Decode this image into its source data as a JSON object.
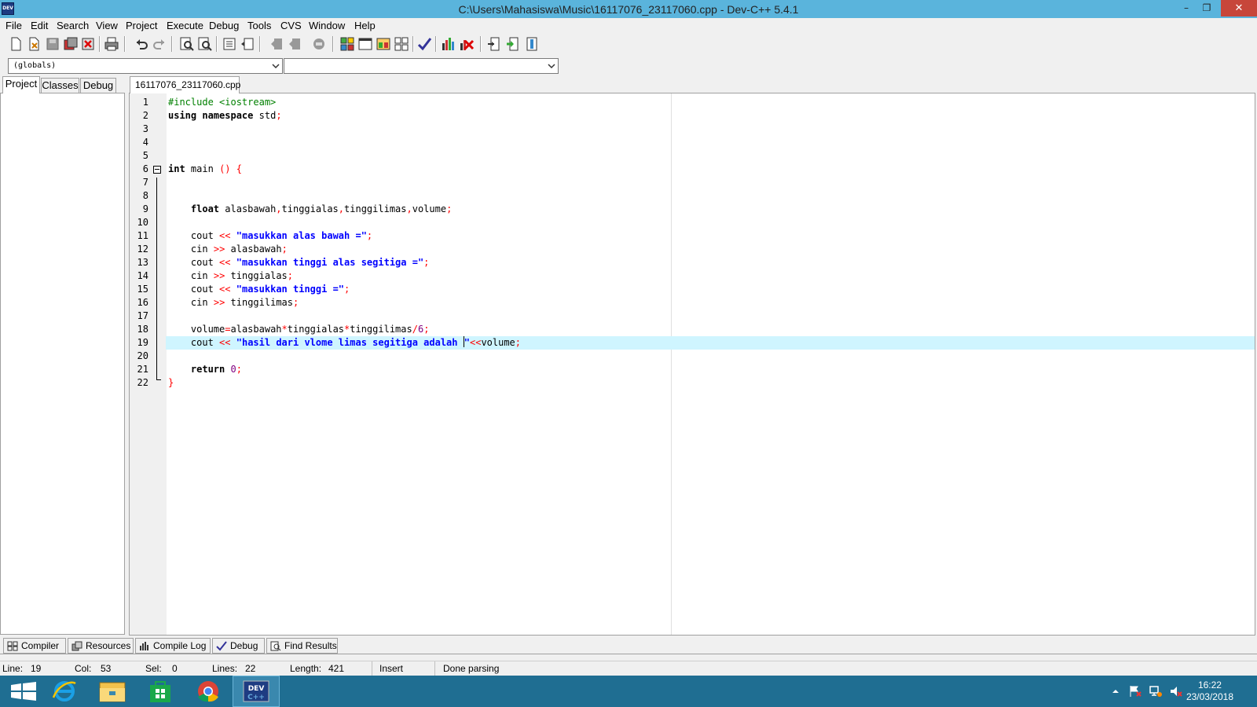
{
  "window": {
    "title": "C:\\Users\\Mahasiswa\\Music\\16117076_23117060.cpp - Dev-C++ 5.4.1",
    "icon": "DEV",
    "minimize": "–",
    "restore": "❐",
    "close": "✕"
  },
  "menu": [
    "File",
    "Edit",
    "Search",
    "View",
    "Project",
    "Execute",
    "Debug",
    "Tools",
    "CVS",
    "Window",
    "Help"
  ],
  "combos": {
    "left": "(globals)",
    "right": ""
  },
  "left_tabs": [
    "Project",
    "Classes",
    "Debug"
  ],
  "editor_tab": "16117076_23117060.cpp",
  "code_lines": [
    "#include <iostream>",
    "using namespace std;",
    "",
    "",
    "",
    "int main () {",
    "",
    "",
    "    float alasbawah,tinggialas,tinggilimas,volume;",
    "",
    "    cout << \"masukkan alas bawah =\";",
    "    cin >> alasbawah;",
    "    cout << \"masukkan tinggi alas segitiga =\";",
    "    cin >> tinggialas;",
    "    cout << \"masukkan tinggi =\";",
    "    cin >> tinggilimas;",
    "",
    "    volume=alasbawah*tinggialas*tinggilimas/6;",
    "    cout << \"hasil dari vlome limas segitiga adalah \"<<volume;",
    "",
    "    return 0;",
    "}"
  ],
  "current_line": 19,
  "caret_col": 53,
  "bottom_tabs": [
    "Compiler",
    "Resources",
    "Compile Log",
    "Debug",
    "Find Results"
  ],
  "status": {
    "line_label": "Line:",
    "line": "19",
    "col_label": "Col:",
    "col": "53",
    "sel_label": "Sel:",
    "sel": "0",
    "lines_label": "Lines:",
    "lines": "22",
    "length_label": "Length:",
    "length": "421",
    "mode": "Insert",
    "message": "Done parsing"
  },
  "taskbar": {
    "time": "16:22",
    "date": "23/03/2018",
    "apps": [
      "start-button",
      "internet-explorer",
      "file-explorer",
      "windows-store",
      "chrome",
      "dev-cpp"
    ]
  },
  "colors": {
    "titlebar": "#5ab4dc",
    "current_line": "#cff5ff",
    "preprocessor": "#008000",
    "string": "#0000ff",
    "symbol": "#ff0000",
    "number": "#800080",
    "taskbar": "#1f6e92"
  }
}
